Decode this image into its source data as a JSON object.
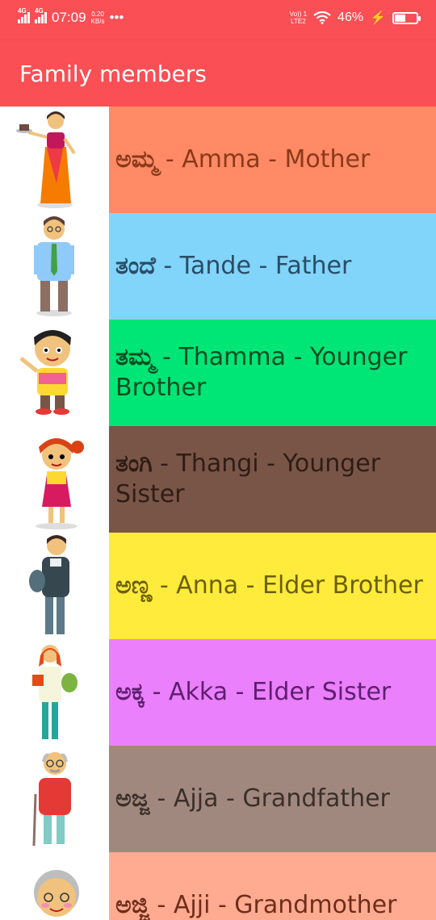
{
  "status_bar": {
    "net1": "4G",
    "net2": "4G",
    "time": "07:09",
    "speed": "0.20",
    "speed_unit": "KB/s",
    "more": "•••",
    "volte": "Vo)) 1",
    "lte": "LTE2",
    "battery": "46%"
  },
  "app_bar": {
    "title": "Family members"
  },
  "members": [
    {
      "kannada": "ಅಮ್ಮ",
      "rest": " - Amma - Mother",
      "color": "#ff8a65",
      "icon": "mother-illustration"
    },
    {
      "kannada": "ತಂದೆ",
      "rest": " - Tande - Father",
      "color": "#81d4fa",
      "icon": "father-illustration"
    },
    {
      "kannada": "ತಮ್ಮ",
      "rest": " - Thamma - Younger Brother",
      "color": "#00e676",
      "icon": "younger-brother-illustration"
    },
    {
      "kannada": "ತಂಗಿ",
      "rest": " - Thangi - Younger Sister",
      "color": "#795548",
      "icon": "younger-sister-illustration"
    },
    {
      "kannada": "ಅಣ್ಣ",
      "rest": " - Anna - Elder Brother",
      "color": "#ffeb3b",
      "icon": "elder-brother-illustration"
    },
    {
      "kannada": "ಅಕ್ಕ",
      "rest": " - Akka - Elder Sister",
      "color": "#ea80fc",
      "icon": "elder-sister-illustration"
    },
    {
      "kannada": "ಅಜ್ಜ",
      "rest": " - Ajja - Grandfather",
      "color": "#a1887f",
      "icon": "grandfather-illustration"
    },
    {
      "kannada": "ಅಜ್ಜಿ",
      "rest": " - Ajji - Grandmother",
      "color": "#ffab91",
      "icon": "grandmother-illustration"
    }
  ]
}
